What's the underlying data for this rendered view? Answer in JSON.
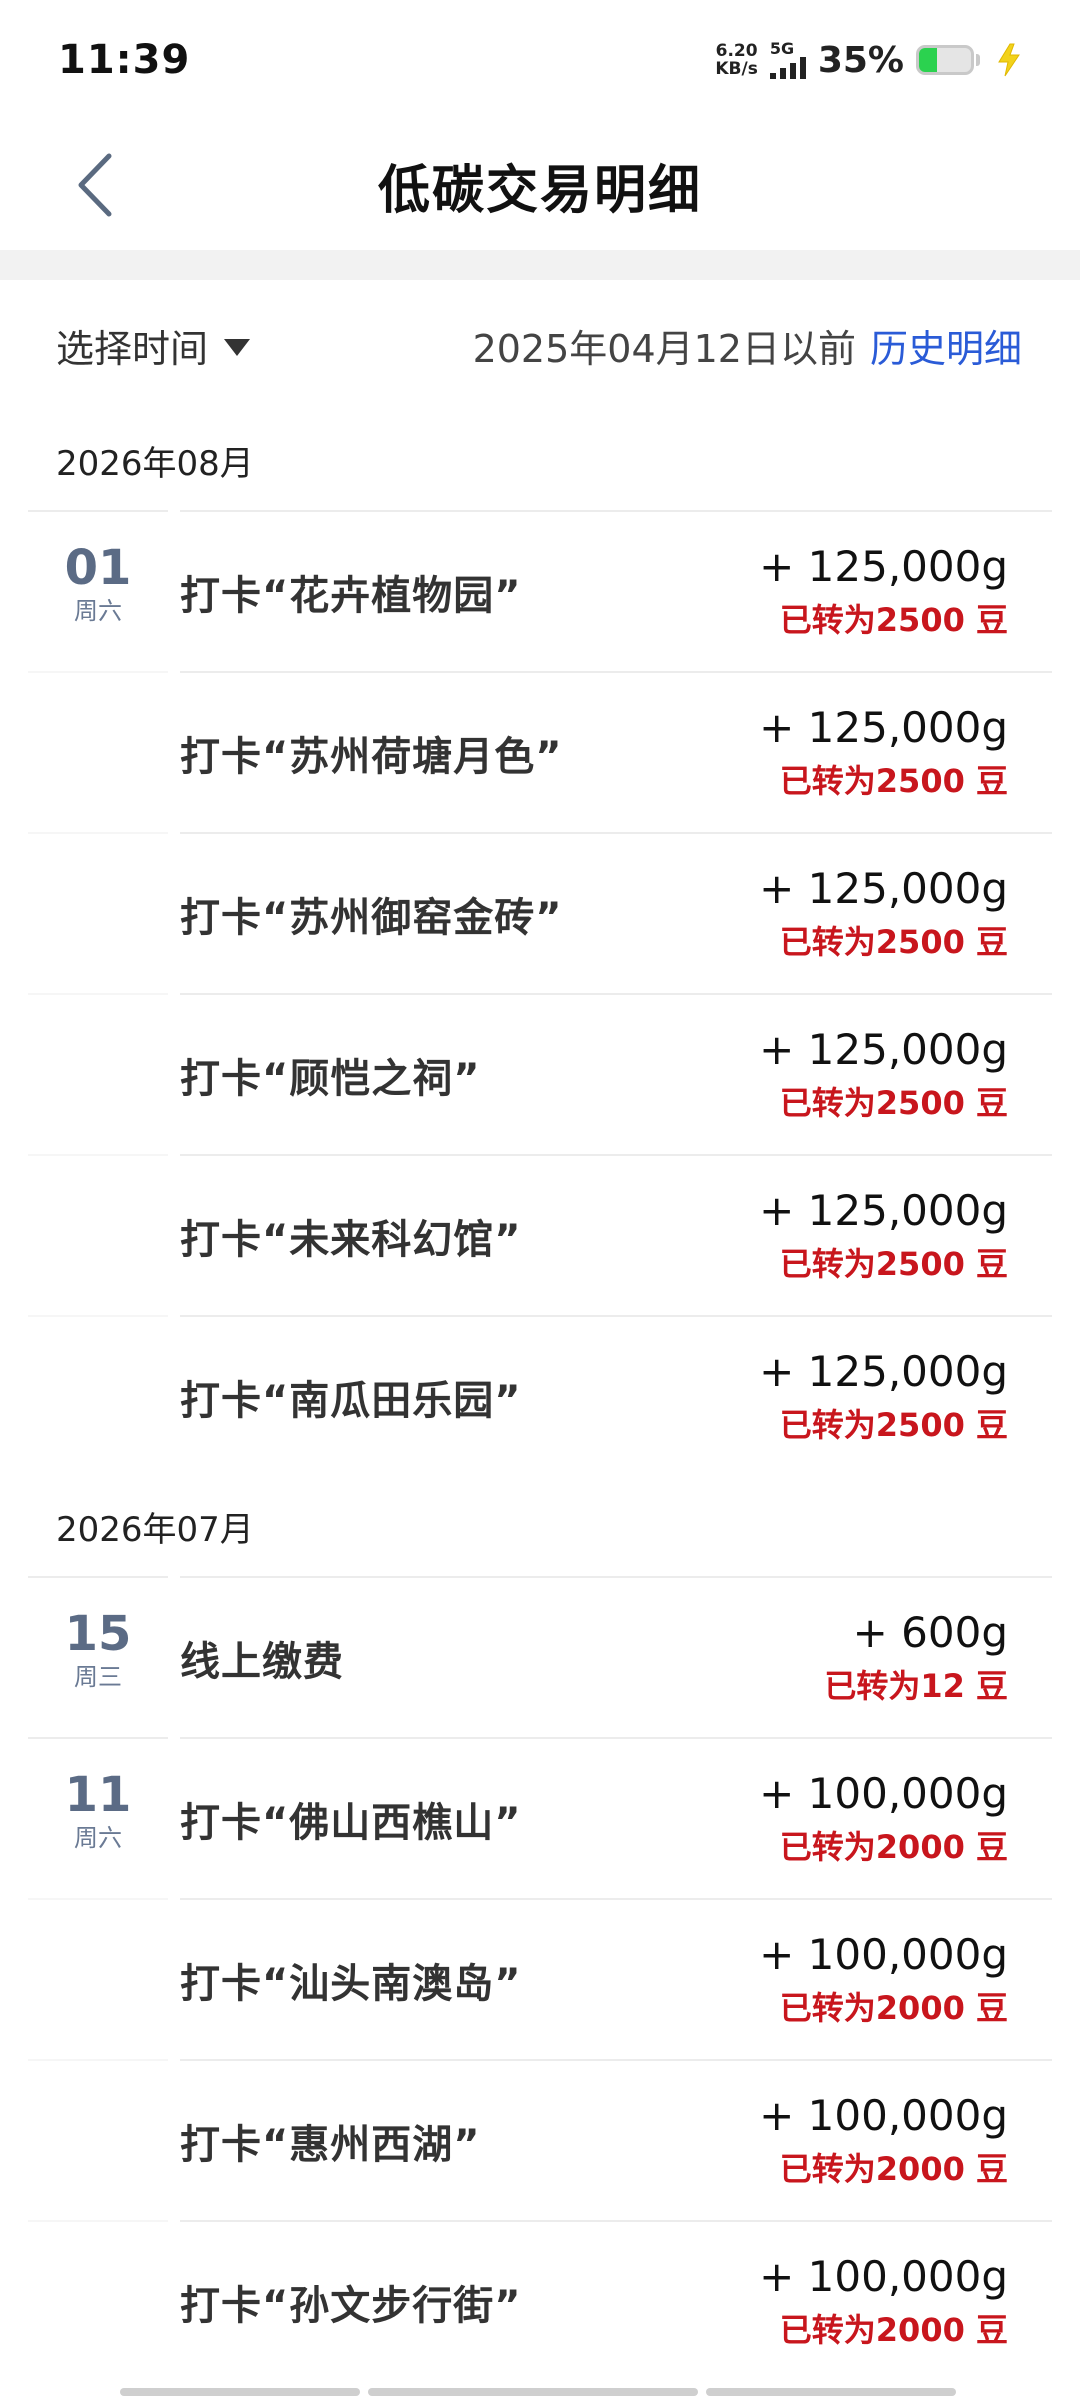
{
  "status_bar": {
    "time": "11:39",
    "net_speed_value": "6.20",
    "net_speed_unit": "KB/s",
    "network_type": "5G",
    "battery_percent": "35%",
    "battery_level": 0.35,
    "battery_color": "#2bd24f"
  },
  "header": {
    "title": "低碳交易明细",
    "back_icon": "chevron-left-icon"
  },
  "filter": {
    "time_select_label": "选择时间",
    "date_hint": "2025年04月12日以前",
    "history_link": "历史明细",
    "link_color": "#2a5bd7"
  },
  "months": [
    {
      "label": "2026年08月",
      "days": [
        {
          "day": "01",
          "weekday": "周六",
          "items": [
            {
              "title": "打卡“花卉植物园”",
              "amount": "+ 125,000g",
              "converted": "已转为2500 豆"
            },
            {
              "title": "打卡“苏州荷塘月色”",
              "amount": "+ 125,000g",
              "converted": "已转为2500 豆"
            },
            {
              "title": "打卡“苏州御窑金砖”",
              "amount": "+ 125,000g",
              "converted": "已转为2500 豆"
            },
            {
              "title": "打卡“顾恺之祠”",
              "amount": "+ 125,000g",
              "converted": "已转为2500 豆"
            },
            {
              "title": "打卡“未来科幻馆”",
              "amount": "+ 125,000g",
              "converted": "已转为2500 豆"
            },
            {
              "title": "打卡“南瓜田乐园”",
              "amount": "+ 125,000g",
              "converted": "已转为2500 豆"
            }
          ]
        }
      ]
    },
    {
      "label": "2026年07月",
      "days": [
        {
          "day": "15",
          "weekday": "周三",
          "items": [
            {
              "title": "线上缴费",
              "amount": "+ 600g",
              "converted": "已转为12 豆"
            }
          ]
        },
        {
          "day": "11",
          "weekday": "周六",
          "items": [
            {
              "title": "打卡“佛山西樵山”",
              "amount": "+ 100,000g",
              "converted": "已转为2000 豆"
            },
            {
              "title": "打卡“汕头南澳岛”",
              "amount": "+ 100,000g",
              "converted": "已转为2000 豆"
            },
            {
              "title": "打卡“惠州西湖”",
              "amount": "+ 100,000g",
              "converted": "已转为2000 豆"
            },
            {
              "title": "打卡“孙文步行街”",
              "amount": "+ 100,000g",
              "converted": "已转为2000 豆"
            }
          ]
        }
      ]
    }
  ],
  "colors": {
    "converted_text": "#c8161d",
    "day_number": "#5b6b85"
  }
}
